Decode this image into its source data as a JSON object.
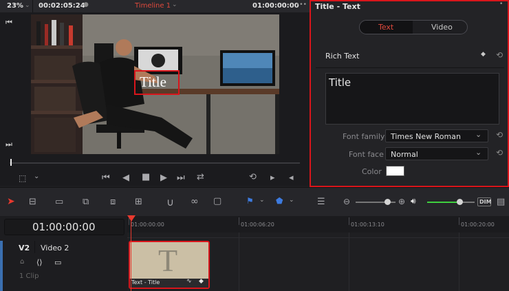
{
  "topbar": {
    "zoom": "23%",
    "timecode_duration": "00:02:05:24",
    "timeline_name": "Timeline 1",
    "current_timecode": "01:00:00:00",
    "more": "•••"
  },
  "preview": {
    "title_overlay": "Title"
  },
  "inspector": {
    "title": "Title - Text",
    "tabs": [
      {
        "label": "Text",
        "active": true
      },
      {
        "label": "Video",
        "active": false
      }
    ],
    "section": "Rich Text",
    "text_value": "Title",
    "fields": {
      "font_family_label": "Font family",
      "font_family_value": "Times New Roman",
      "font_face_label": "Font face",
      "font_face_value": "Normal",
      "color_label": "Color",
      "color_value": "#ffffff"
    },
    "accent": "#e0493c"
  },
  "timeline": {
    "timecode": "01:00:00:00",
    "ruler": [
      "01:00:00:00",
      "01:00:06:20",
      "01:00:13:10",
      "01:00:20:00"
    ],
    "track": {
      "id": "V2",
      "name": "Video 2",
      "clip_count": "1 Clip"
    },
    "clip": {
      "label": "Text - Title",
      "glyph": "T"
    },
    "toolbar": {
      "dim": "DIM"
    }
  },
  "colors": {
    "playhead": "#e8392e",
    "selection": "#d9151b",
    "clip_bg": "#cbbfa5",
    "level": "#3fcf3f"
  }
}
